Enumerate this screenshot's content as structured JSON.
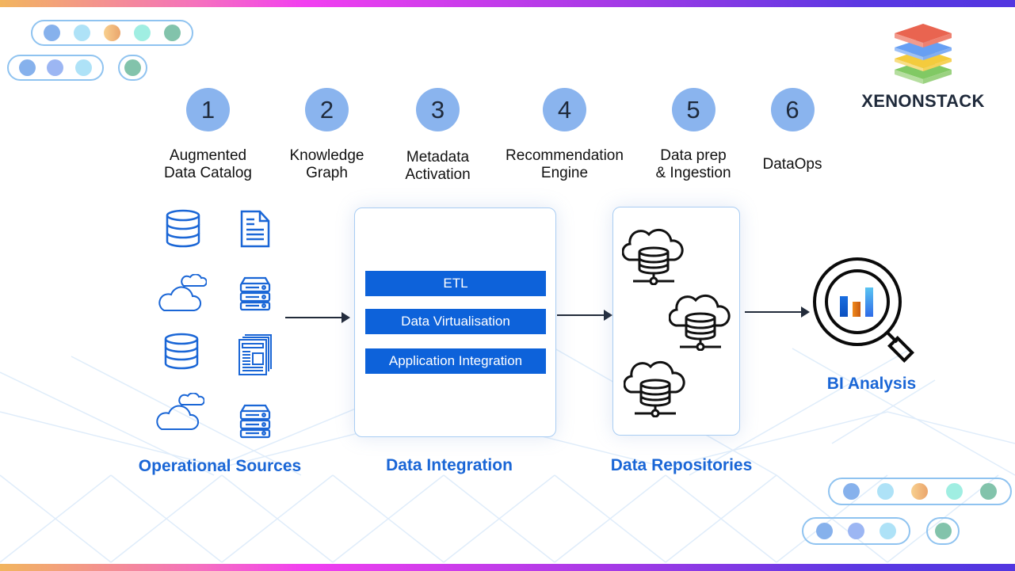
{
  "brand": {
    "name": "XENONSTACK",
    "icon": "stacked-layers-logo-icon"
  },
  "colors": {
    "accent": "#1a66d6",
    "method_fill": "#0d62da",
    "step_circle": "#8ab4ee",
    "dots": [
      "#86b1ec",
      "#aee2f7",
      "#f2bf80",
      "#a0eee2",
      "#82c3ab",
      "#9cb6f3"
    ]
  },
  "steps": [
    {
      "num": "1",
      "label": "Augmented\nData Catalog"
    },
    {
      "num": "2",
      "label": "Knowledge\nGraph"
    },
    {
      "num": "3",
      "label": "Metadata\nActivation"
    },
    {
      "num": "4",
      "label": "Recommendation\nEngine"
    },
    {
      "num": "5",
      "label": "Data prep\n& Ingestion"
    },
    {
      "num": "6",
      "label": "DataOps"
    }
  ],
  "sources": {
    "title": "Operational Sources",
    "icons": [
      "database-icon",
      "document-icon",
      "cloud-icon",
      "server-icon",
      "database-icon",
      "newspaper-icon",
      "cloud-icon",
      "server-icon"
    ]
  },
  "integration": {
    "title": "Data Integration",
    "methods": [
      "ETL",
      "Data Virtualisation",
      "Application Integration"
    ]
  },
  "repositories": {
    "title": "Data Repositories",
    "icons": [
      "cloud-database-icon",
      "cloud-database-icon",
      "cloud-database-icon"
    ]
  },
  "analysis": {
    "title": "BI Analysis",
    "icon": "magnifier-chart-icon"
  }
}
